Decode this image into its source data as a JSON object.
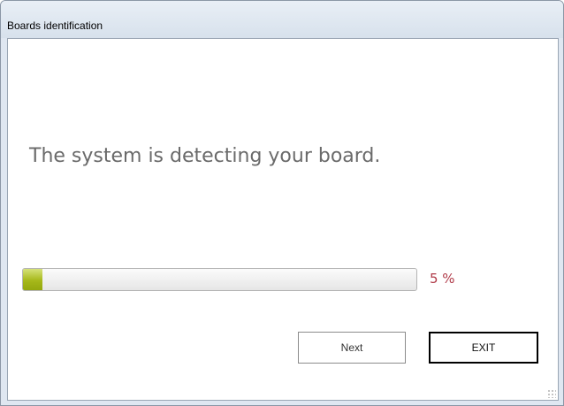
{
  "window": {
    "title": "Boards identification"
  },
  "main": {
    "message": "The system is detecting your board.",
    "progress": {
      "value_percent": 5,
      "label": "5 %"
    }
  },
  "buttons": {
    "next_label": "Next",
    "exit_label": "EXIT"
  }
}
